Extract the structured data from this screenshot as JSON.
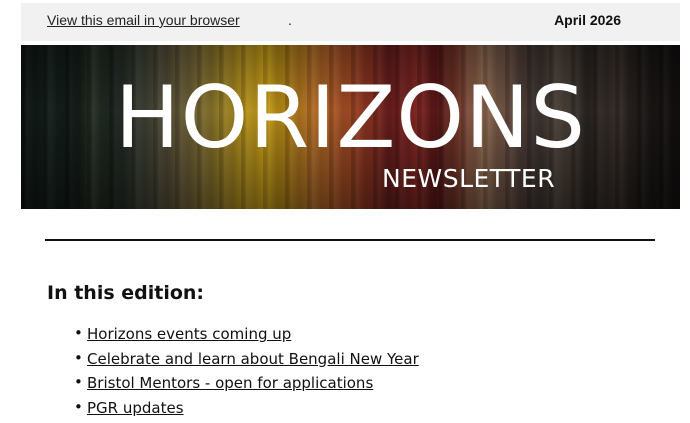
{
  "header": {
    "view_link": "View this email in your browser",
    "view_suffix": ".",
    "date": "April 2026"
  },
  "banner": {
    "title": "HORIZONS",
    "subtitle": "NEWSLETTER"
  },
  "contents": {
    "heading": "In this edition:",
    "items": [
      {
        "label": "Horizons events coming up"
      },
      {
        "label": "Celebrate and learn about Bengali New Year"
      },
      {
        "label": "Bristol Mentors - open for applications"
      },
      {
        "label": "PGR updates"
      }
    ]
  }
}
